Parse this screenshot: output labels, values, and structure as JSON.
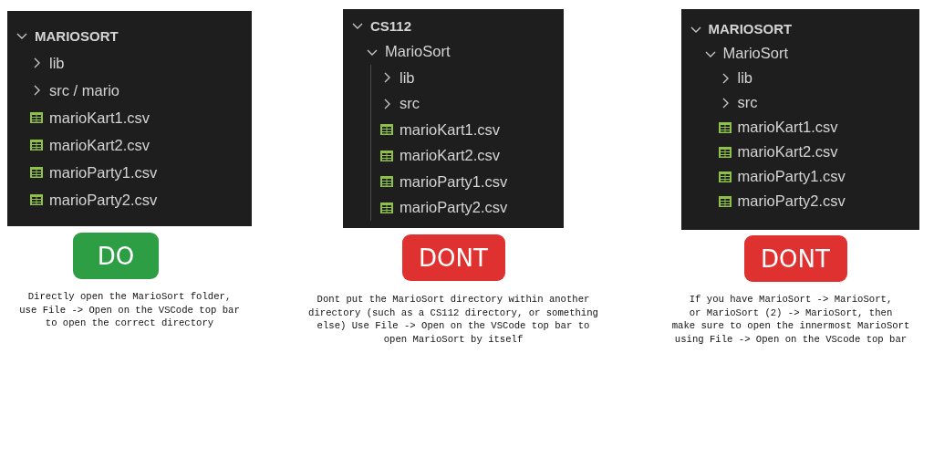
{
  "panels": [
    {
      "indent_guides": false,
      "tree": [
        {
          "kind": "root",
          "label": "MARIOSORT",
          "expanded": true,
          "children": [
            {
              "kind": "folder",
              "label": "lib",
              "expanded": false
            },
            {
              "kind": "folder",
              "label": "src / mario",
              "expanded": false
            },
            {
              "kind": "file",
              "label": "marioKart1.csv"
            },
            {
              "kind": "file",
              "label": "marioKart2.csv"
            },
            {
              "kind": "file",
              "label": "marioParty1.csv"
            },
            {
              "kind": "file",
              "label": "marioParty2.csv"
            }
          ]
        }
      ],
      "badge": {
        "label": "DO",
        "kind": "do"
      },
      "description": "Directly open the MarioSort folder,\nuse File -> Open on the VSCode top bar\nto open the correct directory"
    },
    {
      "indent_guides": true,
      "tree": [
        {
          "kind": "root",
          "label": "CS112",
          "expanded": true,
          "children": [
            {
              "kind": "folder",
              "label": "MarioSort",
              "expanded": true,
              "children": [
                {
                  "kind": "folder",
                  "label": "lib",
                  "expanded": false
                },
                {
                  "kind": "folder",
                  "label": "src",
                  "expanded": false
                },
                {
                  "kind": "file",
                  "label": "marioKart1.csv"
                },
                {
                  "kind": "file",
                  "label": "marioKart2.csv"
                },
                {
                  "kind": "file",
                  "label": "marioParty1.csv"
                },
                {
                  "kind": "file",
                  "label": "marioParty2.csv"
                }
              ]
            }
          ]
        }
      ],
      "badge": {
        "label": "DONT",
        "kind": "dont"
      },
      "description": "Dont put the MarioSort directory within another\ndirectory (such as a CS112 directory, or something\nelse) Use File -> Open on the VSCode top bar to\nopen MarioSort by itself"
    },
    {
      "indent_guides": false,
      "tree": [
        {
          "kind": "root",
          "label": "MARIOSORT",
          "expanded": true,
          "children": [
            {
              "kind": "folder",
              "label": "MarioSort",
              "expanded": true,
              "children": [
                {
                  "kind": "folder",
                  "label": "lib",
                  "expanded": false
                },
                {
                  "kind": "folder",
                  "label": "src",
                  "expanded": false
                },
                {
                  "kind": "file",
                  "label": "marioKart1.csv"
                },
                {
                  "kind": "file",
                  "label": "marioKart2.csv"
                },
                {
                  "kind": "file",
                  "label": "marioParty1.csv"
                },
                {
                  "kind": "file",
                  "label": "marioParty2.csv"
                }
              ]
            }
          ]
        }
      ],
      "badge": {
        "label": "DONT",
        "kind": "dont"
      },
      "description": "If you have MarioSort -> MarioSort,\nor MarioSort (2) -> MarioSort, then\nmake sure to open the innermost MarioSort\nusing File -> Open on the VScode top bar"
    }
  ]
}
